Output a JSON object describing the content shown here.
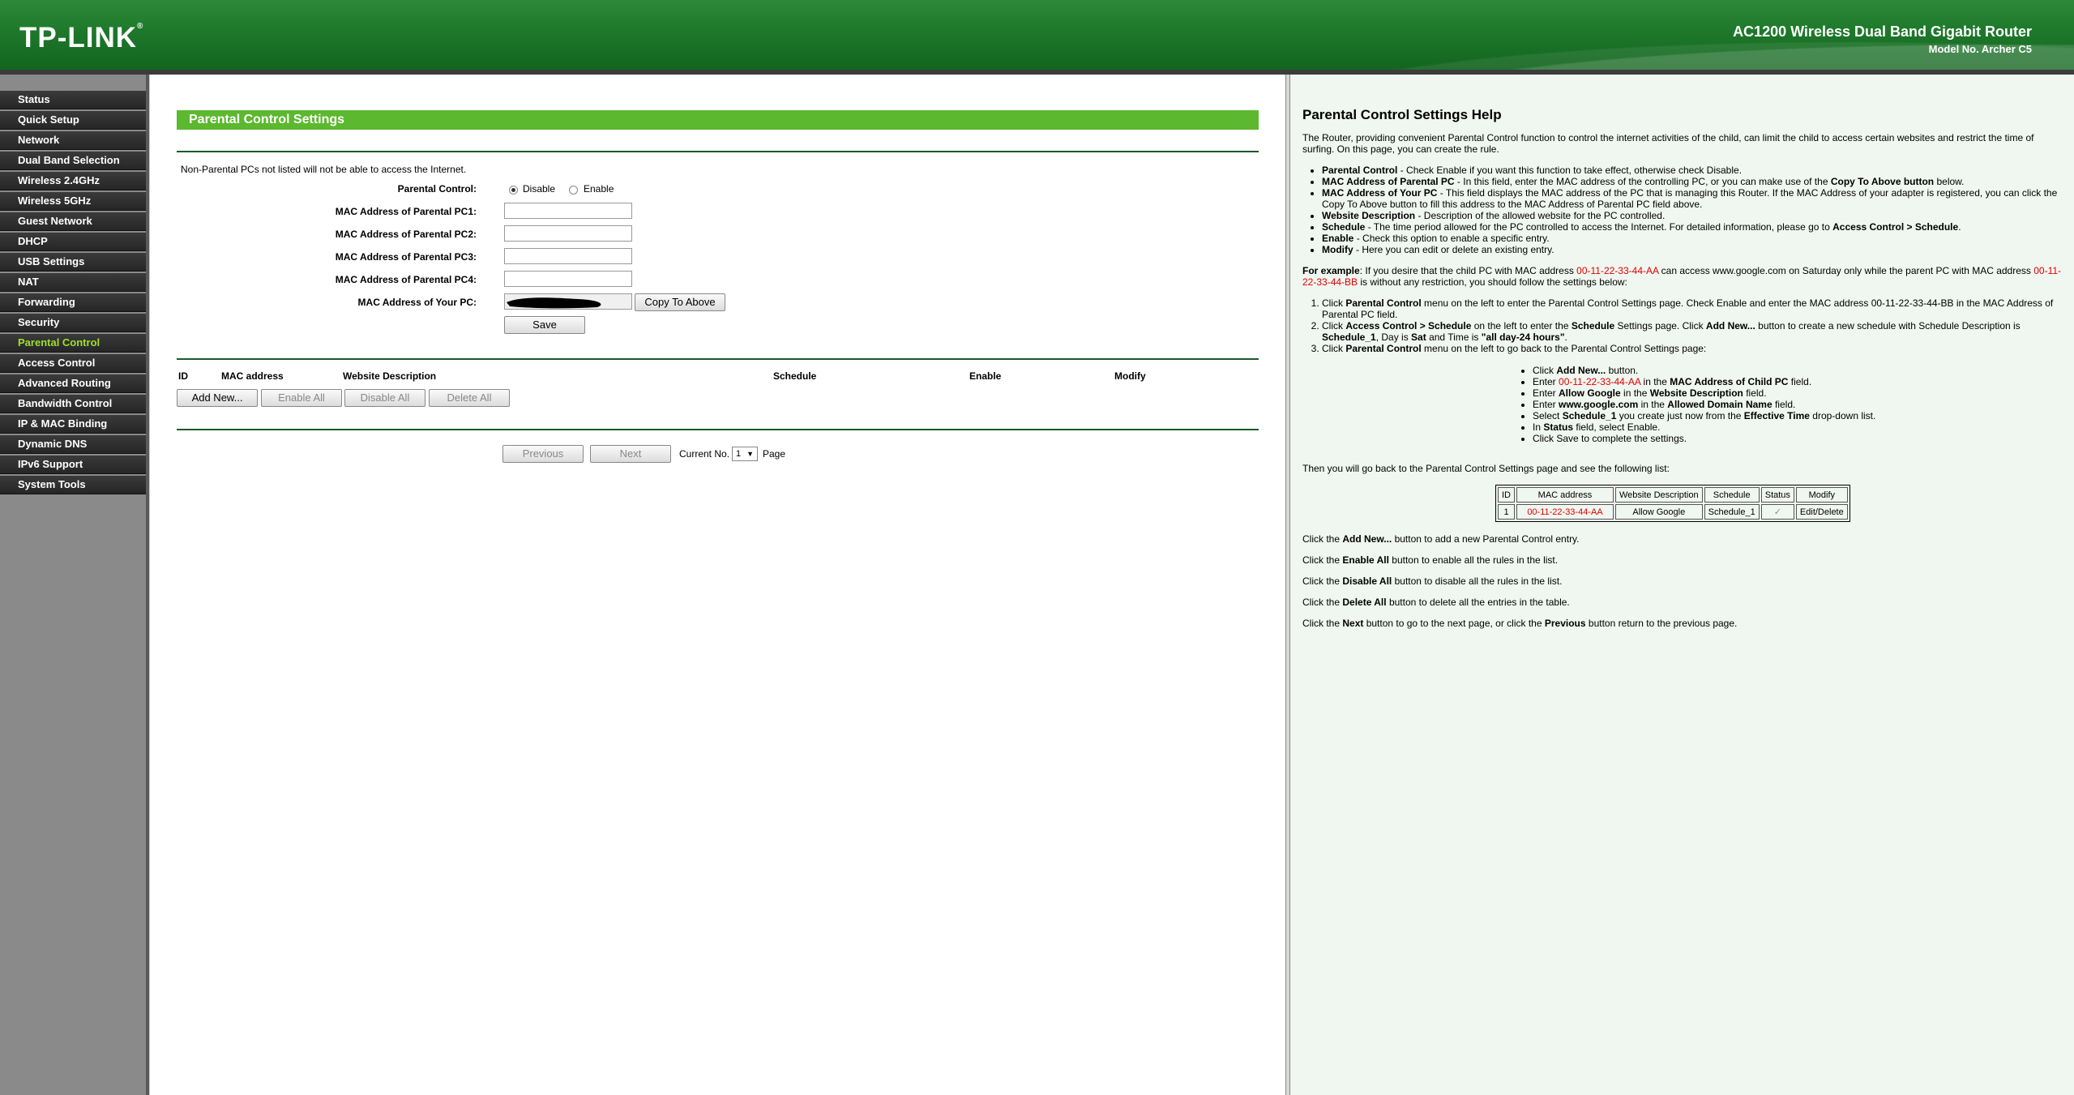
{
  "header": {
    "logo": "TP-LINK",
    "logo_mark": "®",
    "product": "AC1200 Wireless Dual Band Gigabit Router",
    "model": "Model No. Archer C5"
  },
  "sidebar": {
    "items": [
      {
        "label": "Status"
      },
      {
        "label": "Quick Setup"
      },
      {
        "label": "Network"
      },
      {
        "label": "Dual Band Selection"
      },
      {
        "label": "Wireless 2.4GHz"
      },
      {
        "label": "Wireless 5GHz"
      },
      {
        "label": "Guest Network"
      },
      {
        "label": "DHCP"
      },
      {
        "label": "USB Settings"
      },
      {
        "label": "NAT"
      },
      {
        "label": "Forwarding"
      },
      {
        "label": "Security"
      },
      {
        "label": "Parental Control",
        "active": true
      },
      {
        "label": "Access Control"
      },
      {
        "label": "Advanced Routing"
      },
      {
        "label": "Bandwidth Control"
      },
      {
        "label": "IP & MAC Binding"
      },
      {
        "label": "Dynamic DNS"
      },
      {
        "label": "IPv6 Support"
      },
      {
        "label": "System Tools"
      }
    ]
  },
  "main": {
    "title": "Parental Control Settings",
    "notice": "Non-Parental PCs not listed will not be able to access the Internet.",
    "parental_control_label": "Parental Control:",
    "disable_label": "Disable",
    "enable_label": "Enable",
    "selected": "Disable",
    "pc1_label": "MAC Address of Parental PC1:",
    "pc2_label": "MAC Address of Parental PC2:",
    "pc3_label": "MAC Address of Parental PC3:",
    "pc4_label": "MAC Address of Parental PC4:",
    "your_pc_label": "MAC Address of Your PC:",
    "copy_button": "Copy To Above",
    "save_button": "Save",
    "table_headers": {
      "id": "ID",
      "mac": "MAC address",
      "website": "Website Description",
      "schedule": "Schedule",
      "enable": "Enable",
      "modify": "Modify"
    },
    "add_new": "Add New...",
    "enable_all": "Enable All",
    "disable_all": "Disable All",
    "delete_all": "Delete All",
    "previous": "Previous",
    "next": "Next",
    "current_no": "Current No.",
    "page_value": "1",
    "page_label": "Page"
  },
  "help": {
    "title": "Parental Control Settings Help",
    "intro": "The Router, providing convenient Parental Control function to control the internet activities of the child, can limit the child to access certain websites and restrict the time of surfing. On this page, you can create the rule.",
    "b1_term": "Parental Control",
    "b1_text": " - Check Enable if you want this function to take effect, otherwise check Disable.",
    "b2_term": "MAC Address of Parental PC",
    "b2_text": " - In this field, enter the MAC address of the controlling PC, or you can make use of the ",
    "b2_term2": "Copy To Above button",
    "b2_text2": " below.",
    "b3_term": "MAC Address of Your PC",
    "b3_text": " - This field displays the MAC address of the PC that is managing this Router. If the MAC Address of your adapter is registered, you can click the Copy To Above button to fill this address to the MAC Address of Parental PC field above.",
    "b4_term": "Website Description",
    "b4_text": " - Description of the allowed website for the PC controlled.",
    "b5_term": "Schedule",
    "b5_text": " - The time period allowed for the PC controlled to access the Internet. For detailed information, please go to ",
    "b5_term2": "Access Control > Schedule",
    "b5_text2": ".",
    "b6_term": "Enable",
    "b6_text": " - Check this option to enable a specific entry.",
    "b7_term": "Modify",
    "b7_text": " - Here you can edit or delete an existing entry.",
    "ex_lead": "For example",
    "ex_t1": ": If you desire that the child PC with MAC address ",
    "ex_mac1": "00-11-22-33-44-AA",
    "ex_t2": " can access www.google.com on Saturday only while the parent PC with MAC address ",
    "ex_mac2": "00-11-22-33-44-BB",
    "ex_t3": " is without any restriction, you should follow the settings below:",
    "s1_a": "Click ",
    "s1_b": "Parental Control",
    "s1_c": " menu on the left to enter the Parental Control Settings page. Check Enable and enter the MAC address 00-11-22-33-44-BB in the MAC Address of Parental PC field.",
    "s2_a": "Click ",
    "s2_b": "Access Control > Schedule",
    "s2_c": " on the left to enter the ",
    "s2_d": "Schedule",
    "s2_e": " Settings page. Click ",
    "s2_f": "Add New...",
    "s2_g": " button to create a new schedule with Schedule Description is ",
    "s2_h": "Schedule_1",
    "s2_i": ", Day is ",
    "s2_j": "Sat",
    "s2_k": " and Time is ",
    "s2_l": "\"all day-24 hours\"",
    "s2_m": ".",
    "s3_a": "Click ",
    "s3_b": "Parental Control",
    "s3_c": " menu on the left to go back to the Parental Control Settings page:",
    "sub1_a": "Click ",
    "sub1_b": "Add New...",
    "sub1_c": " button.",
    "sub2_a": "Enter ",
    "sub2_b": "00-11-22-33-44-AA",
    "sub2_c": " in the ",
    "sub2_d": "MAC Address of Child PC",
    "sub2_e": " field.",
    "sub3_a": "Enter ",
    "sub3_b": "Allow Google",
    "sub3_c": " in the ",
    "sub3_d": "Website Description",
    "sub3_e": " field.",
    "sub4_a": "Enter ",
    "sub4_b": "www.google.com",
    "sub4_c": " in the ",
    "sub4_d": "Allowed Domain Name",
    "sub4_e": " field.",
    "sub5_a": "Select ",
    "sub5_b": "Schedule_1",
    "sub5_c": " you create just now from the ",
    "sub5_d": "Effective Time",
    "sub5_e": " drop-down list.",
    "sub6_a": "In ",
    "sub6_b": "Status",
    "sub6_c": " field, select Enable.",
    "sub7": "Click Save to complete the settings.",
    "then": "Then you will go back to the Parental Control Settings page and see the following list:",
    "table": {
      "headers": [
        "ID",
        "MAC address",
        "Website Description",
        "Schedule",
        "Status",
        "Modify"
      ],
      "row": [
        "1",
        "00-11-22-33-44-AA",
        "Allow Google",
        "Schedule_1",
        "✓",
        "Edit/Delete"
      ]
    },
    "f1_a": "Click the ",
    "f1_b": "Add New...",
    "f1_c": " button to add a new Parental Control entry.",
    "f2_a": "Click the ",
    "f2_b": "Enable All",
    "f2_c": " button to enable all the rules in the list.",
    "f3_a": "Click the ",
    "f3_b": "Disable All",
    "f3_c": " button to disable all the rules in the list.",
    "f4_a": "Click the ",
    "f4_b": "Delete All",
    "f4_c": " button to delete all the entries in the table.",
    "f5_a": "Click the ",
    "f5_b": "Next",
    "f5_c": " button to go to the next page, or click the ",
    "f5_d": "Previous",
    "f5_e": " button return to the previous page."
  },
  "colors": {
    "header_green": "#1f7a2c",
    "title_green": "#5cb82e",
    "active_nav": "#9ee02b",
    "mac_red": "#e00000"
  }
}
